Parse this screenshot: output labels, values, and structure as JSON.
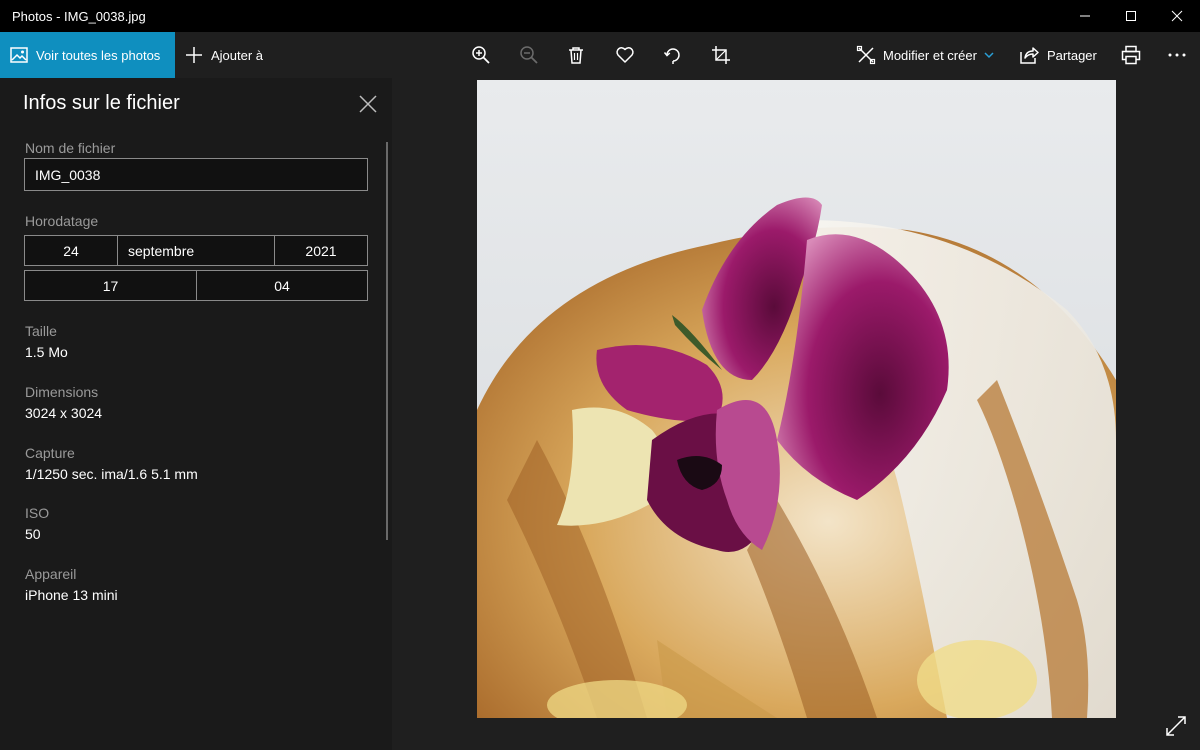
{
  "window": {
    "title": "Photos - IMG_0038.jpg"
  },
  "toolbar": {
    "view_all_label": "Voir toutes les photos",
    "add_to_label": "Ajouter à",
    "edit_label": "Modifier et créer",
    "share_label": "Partager",
    "icons": [
      "zoom-in-icon",
      "zoom-out-icon",
      "trash-icon",
      "heart-icon",
      "rotate-icon",
      "crop-icon",
      "print-icon",
      "more-icon"
    ]
  },
  "info": {
    "title": "Infos sur le fichier",
    "filename_label": "Nom de fichier",
    "filename": "IMG_0038",
    "timestamp_label": "Horodatage",
    "day": "24",
    "month": "septembre",
    "year": "2021",
    "hour": "17",
    "minute": "04",
    "size_label": "Taille",
    "size": "1.5 Mo",
    "dimensions_label": "Dimensions",
    "dimensions": "3024 x 3024",
    "capture_label": "Capture",
    "capture": "1/1250 sec. ima/1.6 5.1 mm",
    "iso_label": "ISO",
    "iso": "50",
    "device_label": "Appareil",
    "device": "iPhone 13 mini"
  },
  "colors": {
    "accent": "#0f8fbf",
    "titlebar": "#000000",
    "panel": "#1a1a1a",
    "background": "#1f1f1f"
  }
}
